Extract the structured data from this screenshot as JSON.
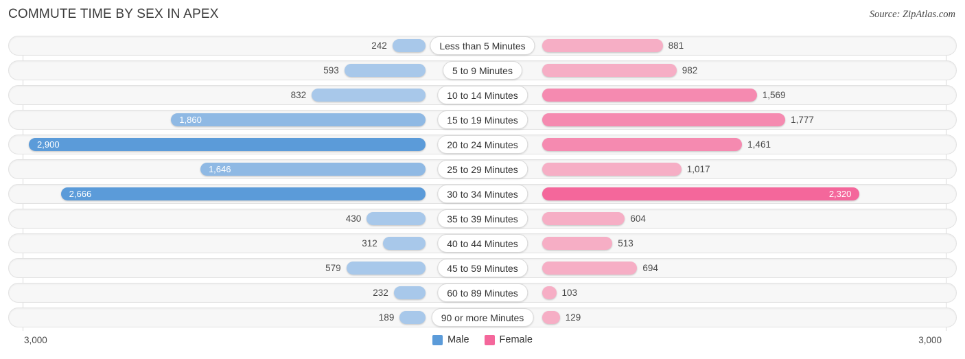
{
  "header": {
    "title": "COMMUTE TIME BY SEX IN APEX",
    "source": "Source: ZipAtlas.com"
  },
  "axis": {
    "left_label": "3,000",
    "right_label": "3,000"
  },
  "legend": {
    "male": {
      "label": "Male",
      "color": "#5B9BD9"
    },
    "female": {
      "label": "Female",
      "color": "#F4679B"
    }
  },
  "colors": {
    "male_light": "#A8C8EA",
    "male_mid": "#8FB9E4",
    "male_dark": "#5B9BD9",
    "female_light": "#F6AEC5",
    "female_mid": "#F58AB0",
    "female_dark": "#F4679B",
    "track": "#f7f7f7",
    "gridline": "#d8d8d8"
  },
  "chart_data": {
    "type": "bar",
    "subtype": "diverging-bidirectional",
    "title": "COMMUTE TIME BY SEX IN APEX",
    "xlabel": "",
    "ylabel": "",
    "xlim": [
      3000,
      3000
    ],
    "axis_left_max": 3000,
    "axis_right_max": 3000,
    "grid": true,
    "legend_position": "bottom-center",
    "categories": [
      "Less than 5 Minutes",
      "5 to 9 Minutes",
      "10 to 14 Minutes",
      "15 to 19 Minutes",
      "20 to 24 Minutes",
      "25 to 29 Minutes",
      "30 to 34 Minutes",
      "35 to 39 Minutes",
      "40 to 44 Minutes",
      "45 to 59 Minutes",
      "60 to 89 Minutes",
      "90 or more Minutes"
    ],
    "series": [
      {
        "name": "Male",
        "direction": "left",
        "values": [
          242,
          593,
          832,
          1860,
          2900,
          1646,
          2666,
          430,
          312,
          579,
          232,
          189
        ],
        "labels": [
          "242",
          "593",
          "832",
          "1,860",
          "2,900",
          "1,646",
          "2,666",
          "430",
          "312",
          "579",
          "232",
          "189"
        ]
      },
      {
        "name": "Female",
        "direction": "right",
        "values": [
          881,
          982,
          1569,
          1777,
          1461,
          1017,
          2320,
          604,
          513,
          694,
          103,
          129
        ],
        "labels": [
          "881",
          "982",
          "1,569",
          "1,777",
          "1,461",
          "1,017",
          "2,320",
          "604",
          "513",
          "694",
          "103",
          "129"
        ]
      }
    ]
  }
}
